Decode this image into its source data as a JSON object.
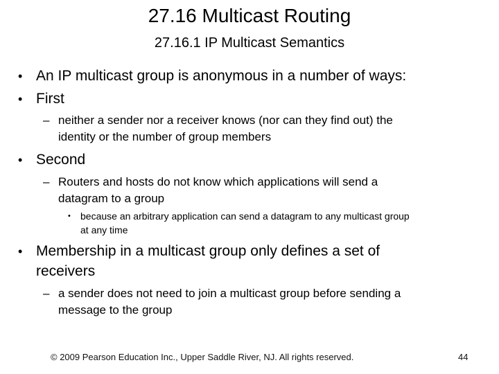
{
  "slide": {
    "title": "27.16  Multicast Routing",
    "subtitle": "27.16.1  IP Multicast Semantics",
    "content": {
      "bullet_1": "An IP multicast group is anonymous in a number of ways:",
      "bullet_2": "First",
      "bullet_2_sub_1_line_1": "neither a sender nor a receiver knows (nor can they find out) the",
      "bullet_2_sub_1_line_2": "identity or the number of group members",
      "bullet_3": "Second",
      "bullet_3_sub_1_line_1": "Routers and hosts do not know which applications will send a",
      "bullet_3_sub_1_line_2": "datagram to a group",
      "bullet_3_sub_1_sub_1_line_1": "because an arbitrary application can send a datagram to any multicast group",
      "bullet_3_sub_1_sub_1_line_2": "at any time",
      "bullet_4_line_1": "Membership in a multicast group only defines a set of",
      "bullet_4_line_2": "receivers",
      "bullet_4_sub_1_line_1": "a sender does not need to join a multicast group before sending a",
      "bullet_4_sub_1_line_2": "message to the group"
    },
    "markers": {
      "bullet": "•",
      "dash": "–"
    },
    "footer": {
      "copyright": "© 2009 Pearson Education Inc., Upper Saddle River, NJ. All rights reserved.",
      "page_number": "44"
    }
  }
}
